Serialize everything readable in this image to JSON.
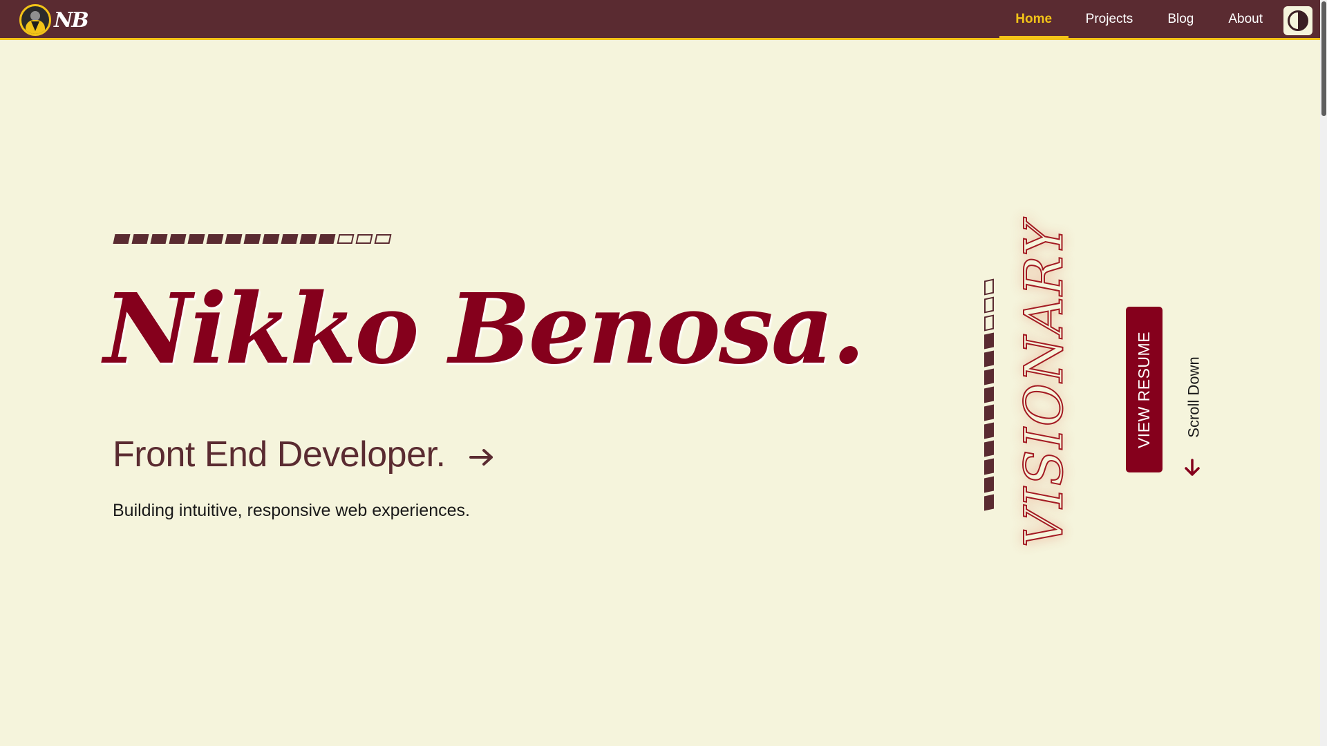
{
  "nav": {
    "logo_text": "NB",
    "links": [
      {
        "label": "Home",
        "active": true
      },
      {
        "label": "Projects",
        "active": false
      },
      {
        "label": "Blog",
        "active": false
      },
      {
        "label": "About",
        "active": false
      }
    ],
    "theme_toggle_icon": "contrast-icon"
  },
  "hero": {
    "name": "Nikko Benosa.",
    "role": "Front End Developer.",
    "tagline": "Building intuitive, responsive web experiences.",
    "progress": {
      "filled": 12,
      "total": 15
    }
  },
  "side": {
    "word": "VISIONARY",
    "vertical_progress": {
      "filled": 10,
      "total": 13
    },
    "resume_label": "VIEW RESUME",
    "scroll_label": "Scroll Down"
  },
  "colors": {
    "nav_bg": "#5a2b31",
    "accent": "#f2c318",
    "brand": "#85001c",
    "page_bg": "#f5f4dc"
  }
}
